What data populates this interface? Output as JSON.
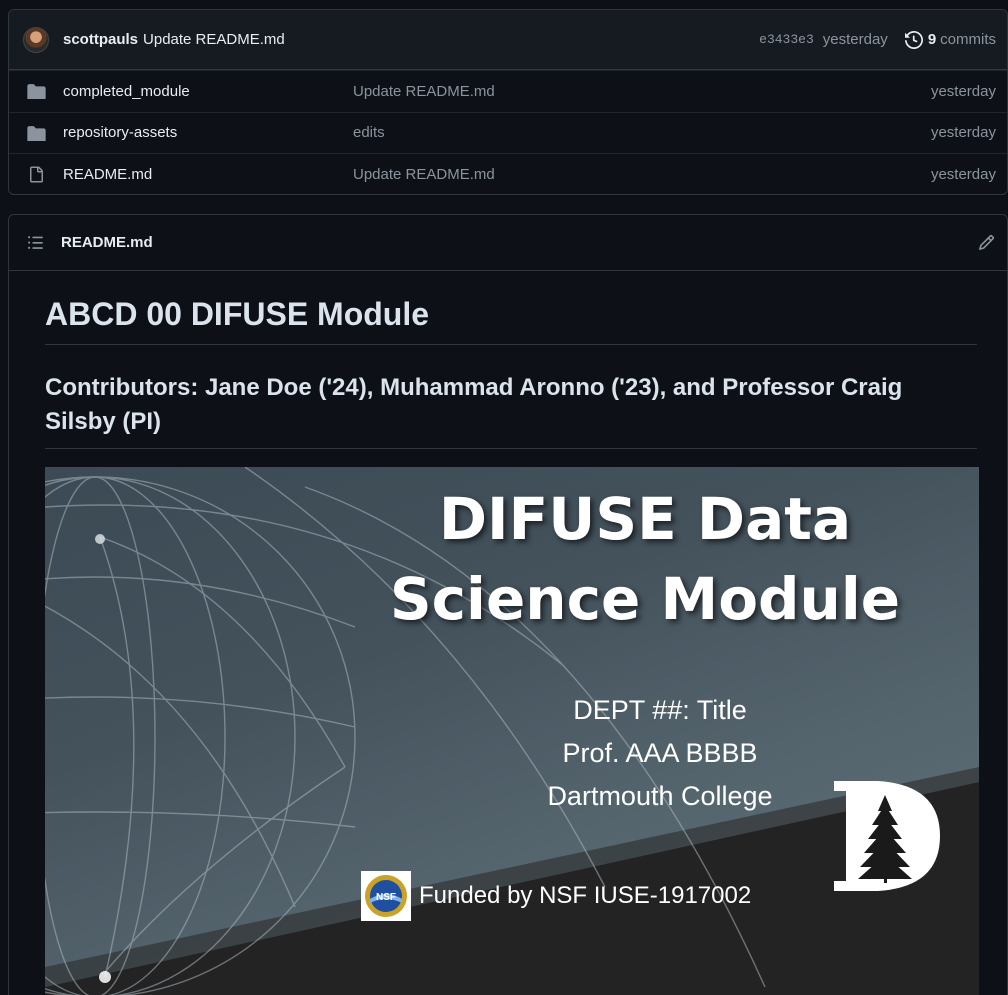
{
  "commit": {
    "author": "scottpauls",
    "message": "Update README.md",
    "sha": "e3433e3",
    "time": "yesterday",
    "commits_count": "9",
    "commits_label": "commits"
  },
  "files": [
    {
      "name": "completed_module",
      "type": "folder",
      "message": "Update README.md",
      "time": "yesterday"
    },
    {
      "name": "repository-assets",
      "type": "folder",
      "message": "edits",
      "time": "yesterday"
    },
    {
      "name": "README.md",
      "type": "file",
      "message": "Update README.md",
      "time": "yesterday"
    }
  ],
  "readme": {
    "filename": "README.md",
    "h1": "ABCD 00 DIFUSE Module",
    "h2": "Contributors: Jane Doe ('24), Muhammad Aronno ('23), and Professor Craig Silsby (PI)"
  },
  "banner": {
    "title_line1": "DIFUSE Data",
    "title_line2": "Science Module",
    "sub_line1": "DEPT ##: Title",
    "sub_line2": "Prof. AAA BBBB",
    "sub_line3": "Dartmouth College",
    "funding": "Funded by NSF IUSE-1917002",
    "nsf_logo_text": "NSF"
  },
  "colors": {
    "background": "#0d1117",
    "header_bg": "#161b22",
    "border": "#30363d",
    "muted": "#8b949e",
    "folder_icon": "#8b949e"
  },
  "icons": {
    "history": "history-icon",
    "folder": "folder-icon",
    "file": "file-icon",
    "list": "list-unordered-icon",
    "edit": "pencil-icon"
  }
}
